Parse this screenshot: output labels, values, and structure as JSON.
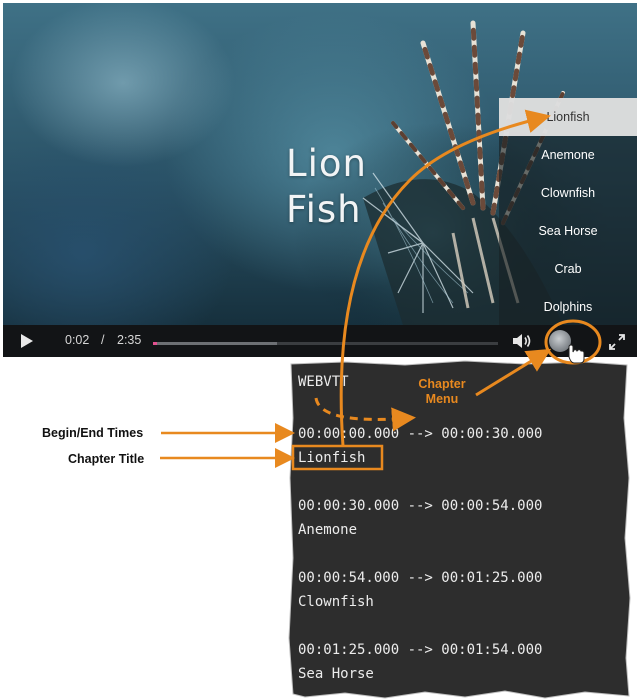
{
  "video": {
    "title_line1": "Lion",
    "title_line2": "Fish",
    "current_time": "0:02",
    "time_separator": "/",
    "duration": "2:35",
    "progress_played": 0.013,
    "progress_buffered": 0.36
  },
  "chapter_menu": {
    "items": [
      "Lionfish",
      "Anemone",
      "Clownfish",
      "Sea Horse",
      "Crab",
      "Dolphins"
    ],
    "active_index": 0
  },
  "vtt": {
    "header": "WEBVTT",
    "cues": [
      {
        "timing": "00:00:00.000 --> 00:00:30.000",
        "title": "Lionfish"
      },
      {
        "timing": "00:00:30.000 --> 00:00:54.000",
        "title": "Anemone"
      },
      {
        "timing": "00:00:54.000 --> 00:01:25.000",
        "title": "Clownfish"
      },
      {
        "timing": "00:01:25.000 --> 00:01:54.000",
        "title": "Sea Horse"
      }
    ]
  },
  "annotations": {
    "begin_end_times": "Begin/End Times",
    "chapter_title": "Chapter Title",
    "chapter_menu_line1": "Chapter",
    "chapter_menu_line2": "Menu"
  },
  "colors": {
    "annotation_orange": "#e8891f",
    "progress_pink": "#e2508f",
    "code_background": "#2d2d2d"
  },
  "icons": [
    "play-icon",
    "volume-icon",
    "chapter-icon",
    "fullscreen-icon",
    "hand-cursor-icon"
  ]
}
